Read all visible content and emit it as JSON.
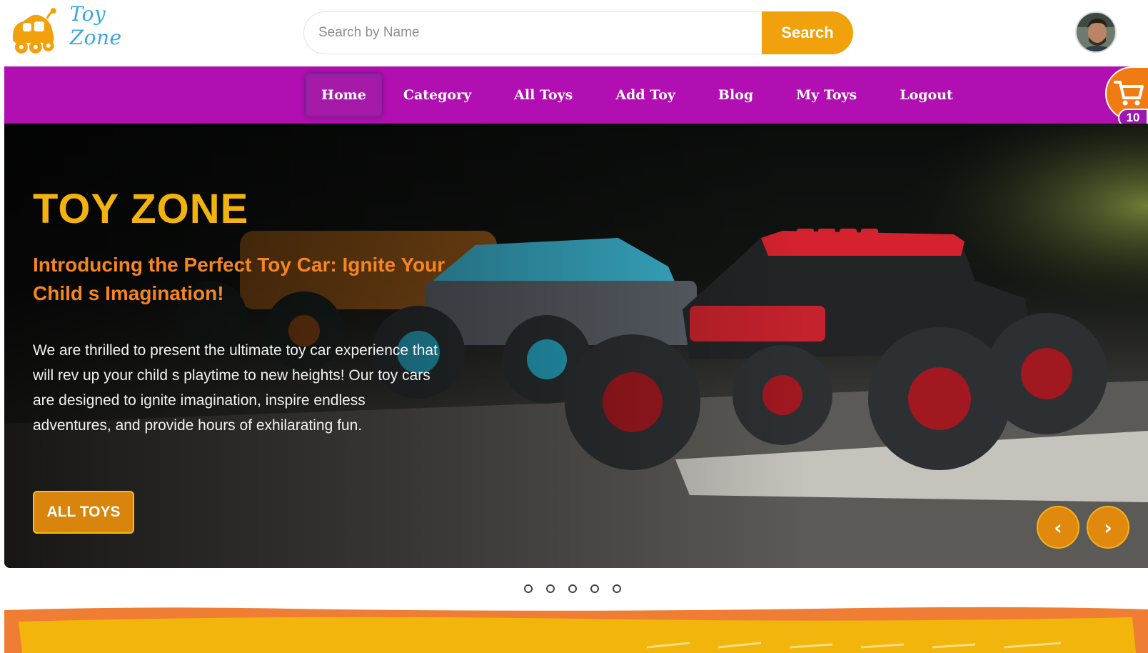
{
  "brand": {
    "name": "Toy Zone",
    "logo_icon": "toy-car-icon",
    "logo_color": "#f0a10c",
    "text_color": "#3aa6dd"
  },
  "search": {
    "placeholder": "Search by Name",
    "value": "",
    "button_label": "Search",
    "button_color": "#f0a10c"
  },
  "user": {
    "avatar_icon": "user-avatar"
  },
  "nav": {
    "background": "#b10fb1",
    "items": [
      {
        "label": "Home",
        "active": true
      },
      {
        "label": "Category",
        "active": false
      },
      {
        "label": "All Toys",
        "active": false
      },
      {
        "label": "Add Toy",
        "active": false
      },
      {
        "label": "Blog",
        "active": false
      },
      {
        "label": "My Toys",
        "active": false
      },
      {
        "label": "Logout",
        "active": false
      }
    ]
  },
  "cart": {
    "icon": "cart-plus-icon",
    "count": "10",
    "color": "#f07b12"
  },
  "hero": {
    "title": "TOY ZONE",
    "subtitle": "Introducing the Perfect Toy Car: Ignite Your Child s Imagination!",
    "description": "We are thrilled to present the ultimate toy car experience that will rev up your child s playtime to new heights! Our toy cars are designed to ignite imagination, inspire endless adventures, and provide hours of exhilarating fun.",
    "button_label": "ALL TOYS",
    "prev_label": "‹",
    "next_label": "›",
    "title_color": "#f3b30f",
    "subtitle_color": "#f58520"
  },
  "slider": {
    "dot_count": 5,
    "active_index": 0
  }
}
